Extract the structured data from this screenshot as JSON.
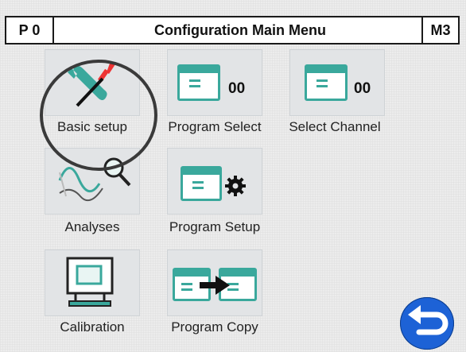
{
  "header": {
    "left_label": "P 0",
    "title": "Configuration Main Menu",
    "right_label": "M3"
  },
  "menu": {
    "basic_setup": {
      "label": "Basic setup",
      "icon": "wrench-screwdriver-icon"
    },
    "program_select": {
      "label": "Program Select",
      "value": "00",
      "icon": "window-icon"
    },
    "select_channel": {
      "label": "Select Channel",
      "value": "00",
      "icon": "window-icon"
    },
    "analyses": {
      "label": "Analyses",
      "icon": "graph-magnifier-icon"
    },
    "program_setup": {
      "label": "Program Setup",
      "icon": "window-gear-icon"
    },
    "calibration": {
      "label": "Calibration",
      "icon": "monitor-icon"
    },
    "program_copy": {
      "label": "Program Copy",
      "icon": "copy-arrow-icon"
    }
  },
  "back_button": {
    "icon": "back-arrow-icon"
  },
  "colors": {
    "accent": "#3aa89c",
    "back": "#1d62d6",
    "header_bg": "#ffffff"
  }
}
